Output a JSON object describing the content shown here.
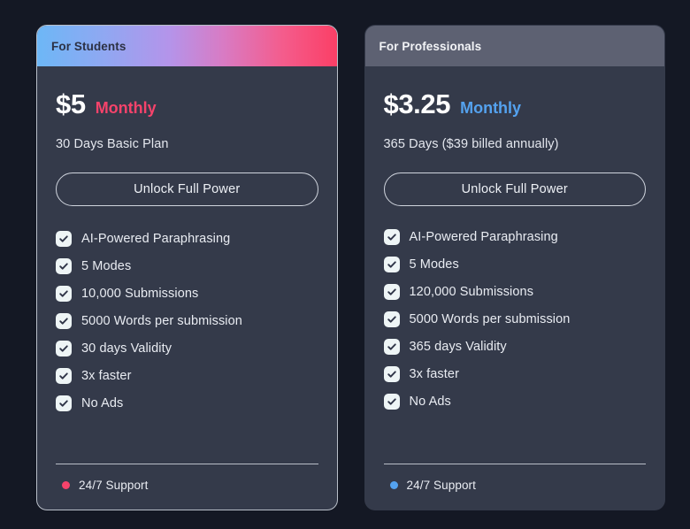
{
  "theme": {
    "page_background": "#141824",
    "card_background": "#343a4a",
    "card_border": "#b9bfc9",
    "pro_header_background": "#5d6172",
    "student_gradient_start": "#6db7f6",
    "student_gradient_mid": "#b494ea",
    "student_gradient_end": "#fb3f66",
    "student_accent": "#f6436b",
    "pro_accent": "#54a2ef",
    "checkbox_background": "#eef5f6",
    "checkbox_glyph": "#2f3548",
    "divider": "#b9bec8",
    "body_text": "#e9ecf2"
  },
  "plans": [
    {
      "header_label": "For Students",
      "price": "$5",
      "period": "Monthly",
      "description": "30 Days Basic Plan",
      "cta_label": "Unlock Full Power",
      "features": [
        "AI-Powered Paraphrasing",
        "5 Modes",
        "10,000 Submissions",
        "5000 Words per submission",
        "30 days Validity",
        "3x faster",
        "No Ads"
      ],
      "support_label": "24/7 Support",
      "support_dot_color": "#f6436b"
    },
    {
      "header_label": "For Professionals",
      "price": "$3.25",
      "period": "Monthly",
      "description": "365 Days ($39 billed annually)",
      "cta_label": "Unlock Full Power",
      "features": [
        "AI-Powered Paraphrasing",
        "5 Modes",
        "120,000 Submissions",
        "5000 Words per submission",
        "365 days Validity",
        "3x faster",
        "No Ads"
      ],
      "support_label": "24/7 Support",
      "support_dot_color": "#54a2ef"
    }
  ]
}
